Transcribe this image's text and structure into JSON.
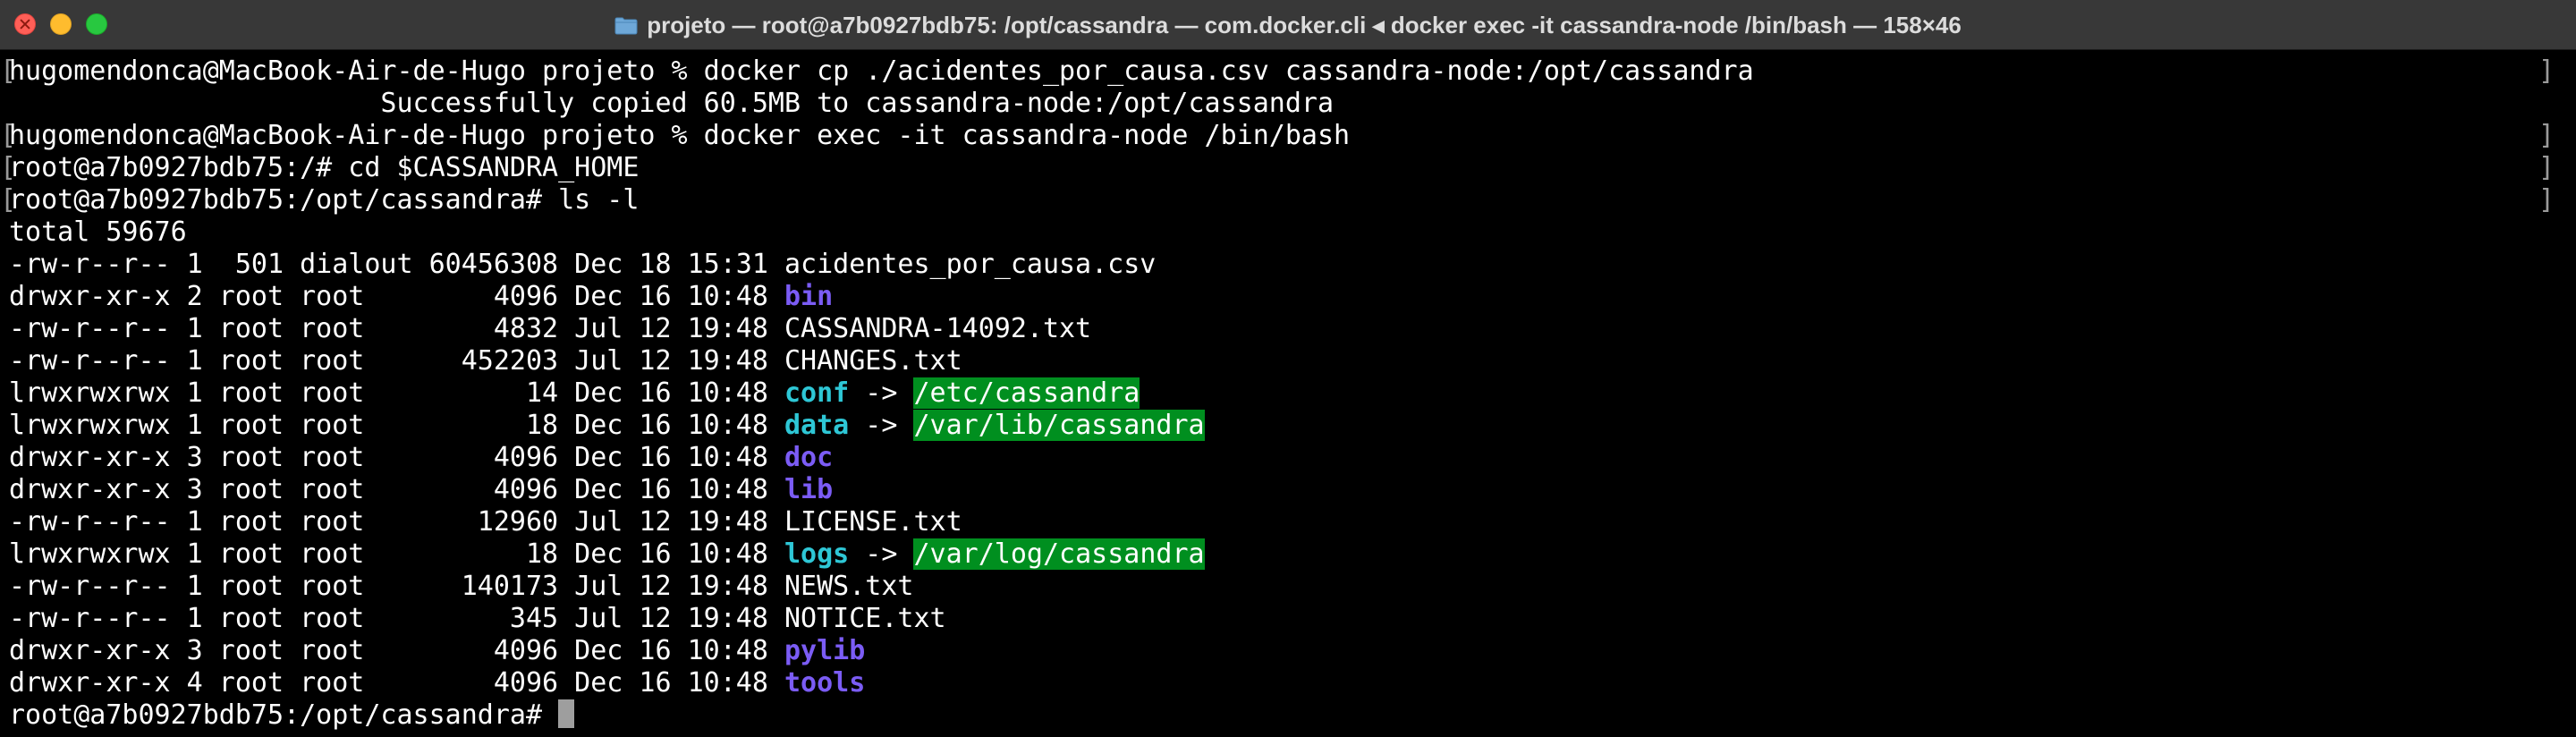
{
  "window": {
    "title": "projeto — root@a7b0927bdb75: /opt/cassandra — com.docker.cli ◂ docker exec -it cassandra-node /bin/bash — 158×46"
  },
  "terminal": {
    "commands": [
      "hugomendonca@MacBook-Air-de-Hugo projeto % docker cp ./acidentes_por_causa.csv cassandra-node:/opt/cassandra",
      "                       Successfully copied 60.5MB to cassandra-node:/opt/cassandra",
      "hugomendonca@MacBook-Air-de-Hugo projeto % docker exec -it cassandra-node /bin/bash",
      "root@a7b0927bdb75:/# cd $CASSANDRA_HOME",
      "root@a7b0927bdb75:/opt/cassandra# ls -l",
      "total 59676"
    ],
    "listing": [
      {
        "meta": "-rw-r--r-- 1  501 dialout 60456308 Dec 18 15:31 ",
        "name": "acidentes_por_causa.csv",
        "kind": "file",
        "arrow": "",
        "target": ""
      },
      {
        "meta": "drwxr-xr-x 2 root root        4096 Dec 16 10:48 ",
        "name": "bin",
        "kind": "dir",
        "arrow": "",
        "target": ""
      },
      {
        "meta": "-rw-r--r-- 1 root root        4832 Jul 12 19:48 ",
        "name": "CASSANDRA-14092.txt",
        "kind": "file",
        "arrow": "",
        "target": ""
      },
      {
        "meta": "-rw-r--r-- 1 root root      452203 Jul 12 19:48 ",
        "name": "CHANGES.txt",
        "kind": "file",
        "arrow": "",
        "target": ""
      },
      {
        "meta": "lrwxrwxrwx 1 root root          14 Dec 16 10:48 ",
        "name": "conf",
        "kind": "link",
        "arrow": " -> ",
        "target": "/etc/cassandra"
      },
      {
        "meta": "lrwxrwxrwx 1 root root          18 Dec 16 10:48 ",
        "name": "data",
        "kind": "link",
        "arrow": " -> ",
        "target": "/var/lib/cassandra"
      },
      {
        "meta": "drwxr-xr-x 3 root root        4096 Dec 16 10:48 ",
        "name": "doc",
        "kind": "dir",
        "arrow": "",
        "target": ""
      },
      {
        "meta": "drwxr-xr-x 3 root root        4096 Dec 16 10:48 ",
        "name": "lib",
        "kind": "dir",
        "arrow": "",
        "target": ""
      },
      {
        "meta": "-rw-r--r-- 1 root root       12960 Jul 12 19:48 ",
        "name": "LICENSE.txt",
        "kind": "file",
        "arrow": "",
        "target": ""
      },
      {
        "meta": "lrwxrwxrwx 1 root root          18 Dec 16 10:48 ",
        "name": "logs",
        "kind": "link",
        "arrow": " -> ",
        "target": "/var/log/cassandra"
      },
      {
        "meta": "-rw-r--r-- 1 root root      140173 Jul 12 19:48 ",
        "name": "NEWS.txt",
        "kind": "file",
        "arrow": "",
        "target": ""
      },
      {
        "meta": "-rw-r--r-- 1 root root         345 Jul 12 19:48 ",
        "name": "NOTICE.txt",
        "kind": "file",
        "arrow": "",
        "target": ""
      },
      {
        "meta": "drwxr-xr-x 3 root root        4096 Dec 16 10:48 ",
        "name": "pylib",
        "kind": "dir",
        "arrow": "",
        "target": ""
      },
      {
        "meta": "drwxr-xr-x 4 root root        4096 Dec 16 10:48 ",
        "name": "tools",
        "kind": "dir",
        "arrow": "",
        "target": ""
      }
    ],
    "prompt": "root@a7b0927bdb75:/opt/cassandra# ",
    "colors": {
      "background": "#000000",
      "text": "#ffffff",
      "directory": "#7b5cf5",
      "symlink": "#2ec7d6",
      "symlink_target_bg": "#008f1f"
    }
  }
}
